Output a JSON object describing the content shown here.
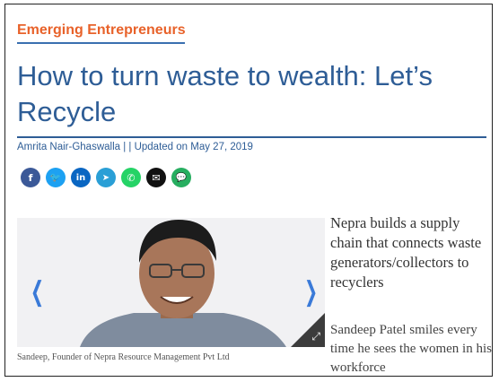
{
  "article": {
    "section": "Emerging Entrepreneurs",
    "title": "How to turn waste to wealth: Let’s Recycle",
    "byline": "Amrita Nair-Ghaswalla | | Updated on May 27, 2019",
    "summary": "Nepra builds a supply chain that connects waste generators/collectors to recyclers",
    "body_start": "Sandeep Patel smiles every time he sees the women in his workforce",
    "caption": "Sandeep, Founder of Nepra Resource Management Pvt Ltd"
  },
  "share_buttons": [
    {
      "icon": "facebook-icon",
      "glyph": "f",
      "color": "#3b5998"
    },
    {
      "icon": "twitter-icon",
      "glyph": "🐦",
      "color": "#1da1f2"
    },
    {
      "icon": "linkedin-icon",
      "glyph": "in",
      "color": "#0a66c2"
    },
    {
      "icon": "telegram-icon",
      "glyph": "➤",
      "color": "#2a9fd6"
    },
    {
      "icon": "whatsapp-icon",
      "glyph": "✆",
      "color": "#25d366"
    },
    {
      "icon": "email-icon",
      "glyph": "✉",
      "color": "#111111"
    },
    {
      "icon": "comment-icon",
      "glyph": "💬",
      "color": "#27ae60"
    }
  ],
  "slider": {
    "prev_glyph": "❮",
    "next_glyph": "❯",
    "expand_glyph": "⤢"
  }
}
